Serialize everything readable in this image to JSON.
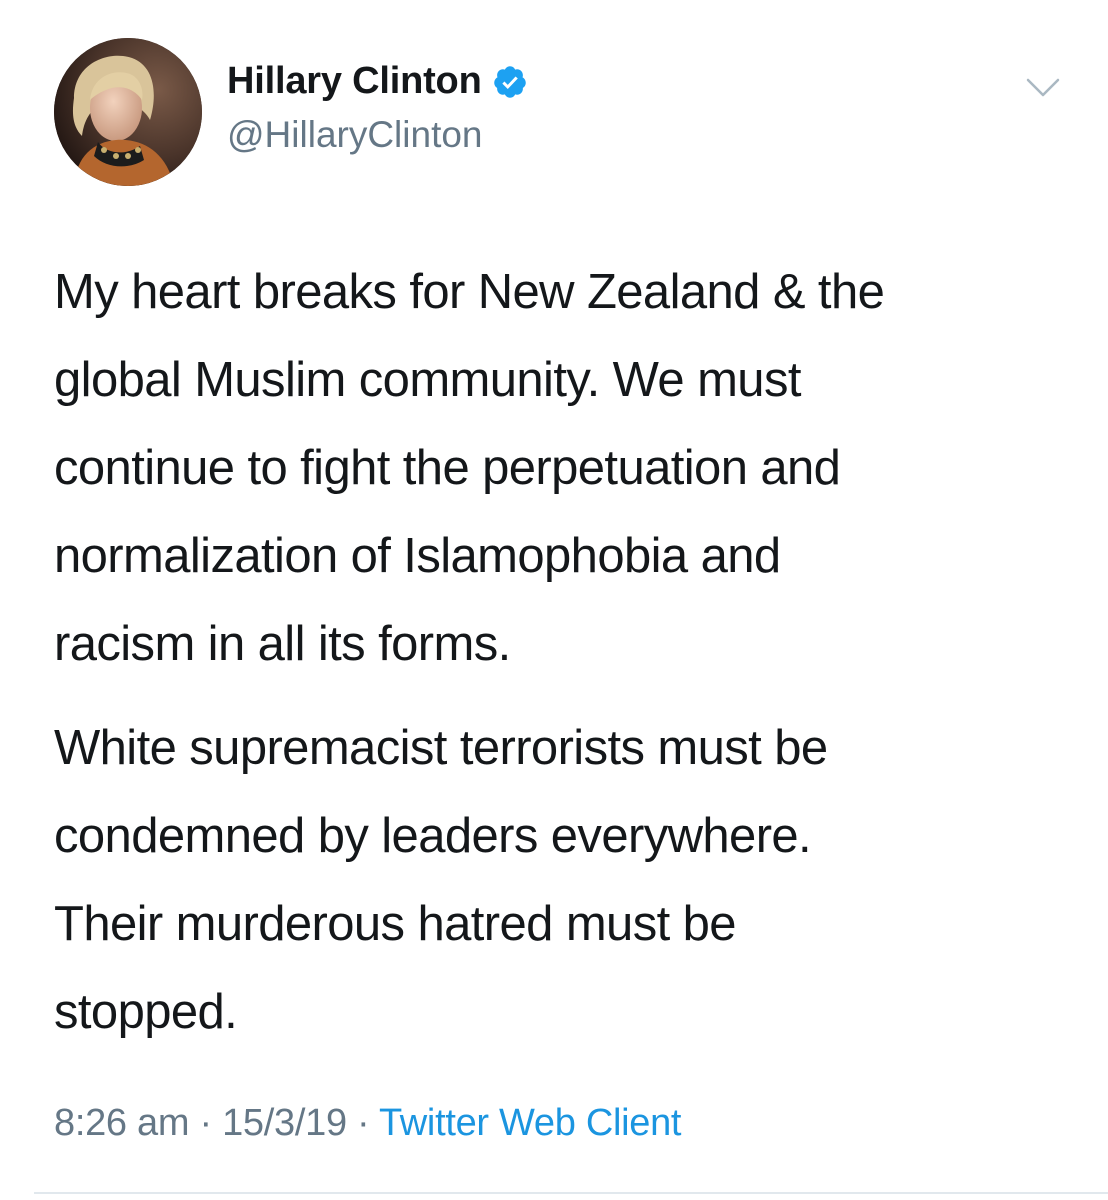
{
  "author": {
    "display_name": "Hillary Clinton",
    "handle": "@HillaryClinton",
    "verified": true
  },
  "tweet": {
    "paragraphs": [
      {
        "lines": [
          "My heart breaks for New Zealand & the",
          "global Muslim community. We must",
          "continue to fight the perpetuation and",
          "normalization of Islamophobia and",
          "racism in all its forms."
        ]
      },
      {
        "lines": [
          "White supremacist terrorists must be",
          "condemned by leaders everywhere.",
          "Their murderous hatred must be",
          "stopped."
        ]
      }
    ]
  },
  "meta": {
    "time": "8:26 am",
    "date": "15/3/19",
    "separator": " · ",
    "source": "Twitter Web Client"
  },
  "icons": {
    "verified": "verified-badge-icon",
    "menu": "chevron-down-icon"
  },
  "colors": {
    "text": "#14171a",
    "secondary": "#657786",
    "link": "#1b95e0",
    "verified": "#1da1f2",
    "divider": "#e1e8ed"
  }
}
